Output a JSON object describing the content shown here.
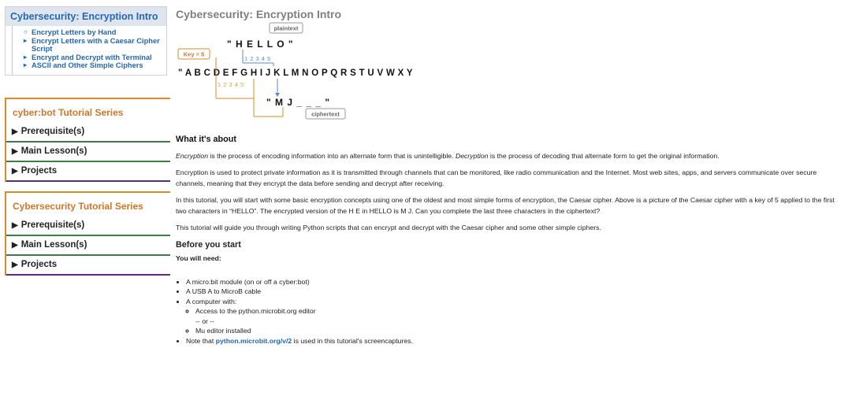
{
  "page_title": "Cybersecurity: Encryption Intro",
  "toc": {
    "title": "Cybersecurity: Encryption Intro",
    "items": [
      {
        "marker": "○",
        "label": "Encrypt Letters by Hand"
      },
      {
        "marker": "▸",
        "label": "Encrypt Letters with a Caesar Cipher Script"
      },
      {
        "marker": "▸",
        "label": "Encrypt and Decrypt with Terminal"
      },
      {
        "marker": "▸",
        "label": "ASCII and Other Simple Ciphers"
      }
    ]
  },
  "series1": {
    "title": "cyber:bot Tutorial Series",
    "items": [
      "Prerequisite(s)",
      "Main Lesson(s)",
      "Projects"
    ]
  },
  "series2": {
    "title": "Cybersecurity Tutorial Series",
    "items": [
      "Prerequisite(s)",
      "Main Lesson(s)",
      "Projects"
    ]
  },
  "diagram": {
    "plaintext_label": "plaintext",
    "hello": "\" H E L L O \"",
    "key_label": "Key = 5",
    "count_top": "1 2 3 4 5",
    "alphabet": "\" A B C D E F G H I J K L M N O P Q R S T U V W X Y Z \"",
    "count_bottom": "1 2 3 4 5",
    "cipher_value": "\" M J _ _ _ \"",
    "ciphertext_label": "ciphertext"
  },
  "content": {
    "about_heading": "What it's about",
    "p1_em1": "Encryption",
    "p1_mid": " is the process of encoding information into an alternate form that is unintelligible.  ",
    "p1_em2": "Decryption",
    "p1_end": " is the process of decoding that alternate form to get the original information.",
    "p2": "Encryption is used to protect private information as it is transmitted through channels that can be monitored, like radio communication and the Internet.  Most web sites, apps, and servers communicate over secure channels, meaning that they encrypt the data before sending and decrypt after receiving.",
    "p3": "In this tutorial, you will start with some basic encryption concepts using one of the oldest and most simple forms of encryption, the Caesar cipher.  Above is a picture of the Caesar cipher with a key of 5 applied to the first two characters in “HELLO”.  The encrypted version of the H E in HELLO is M J.  Can you complete the last three characters in the ciphertext?",
    "p4": "This tutorial will guide you through writing Python scripts that can encrypt and decrypt with the Caesar cipher and some other simple ciphers.",
    "before_heading": "Before you start",
    "need_label": "You will need:",
    "list1": "A micro:bit module (on or off a cyber:bot)",
    "list2": "A USB A to MicroB cable",
    "list3": "A computer with:",
    "sub1": "Access to the python.microbit.org editor",
    "sub_or": "-- or --",
    "sub2": "Mu editor installed",
    "note_pre": "Note that ",
    "note_link": "python.microbit.org/v/2",
    "note_post": " is used in this tutorial's screencaptures."
  }
}
